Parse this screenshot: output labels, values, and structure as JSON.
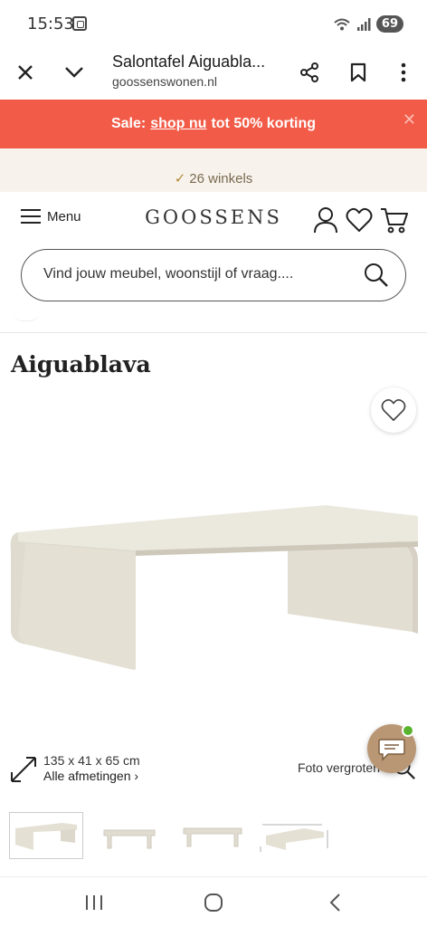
{
  "status_bar": {
    "time": "15:53",
    "battery": "69",
    "icons": [
      "screenshot-icon",
      "wifi-icon",
      "signal-icon",
      "battery-icon"
    ]
  },
  "browser": {
    "title": "Salontafel Aiguabla...",
    "url": "goossenswonen.nl",
    "icons": [
      "close-icon",
      "chevron-down-icon",
      "share-icon",
      "bookmark-icon",
      "more-vertical-icon"
    ]
  },
  "sale_banner": {
    "prefix": "Sale:",
    "link": "shop nu",
    "suffix": "tot 50% korting",
    "background": "#f25b47"
  },
  "promo": {
    "text": "26 winkels",
    "check": "✓"
  },
  "header": {
    "menu_label": "Menu",
    "logo": "GOOSSENS",
    "icons": [
      "hamburger-icon",
      "account-icon",
      "heart-icon",
      "cart-icon"
    ]
  },
  "search": {
    "placeholder": "Vind jouw meubel, woonstijl of vraag...."
  },
  "product": {
    "title": "Aiguablava",
    "dimensions": "135 x 41 x 65 cm",
    "all_dimensions": "Alle afmetingen",
    "zoom_label": "Foto vergroten",
    "thumbnail_count": 4
  },
  "nav_bar": {
    "icons": [
      "recent-apps-icon",
      "home-icon",
      "back-icon"
    ]
  },
  "colors": {
    "accent": "#f25b47",
    "promo_bg": "#f7f3ec",
    "chat": "#b99774",
    "online": "#5ab32f"
  }
}
